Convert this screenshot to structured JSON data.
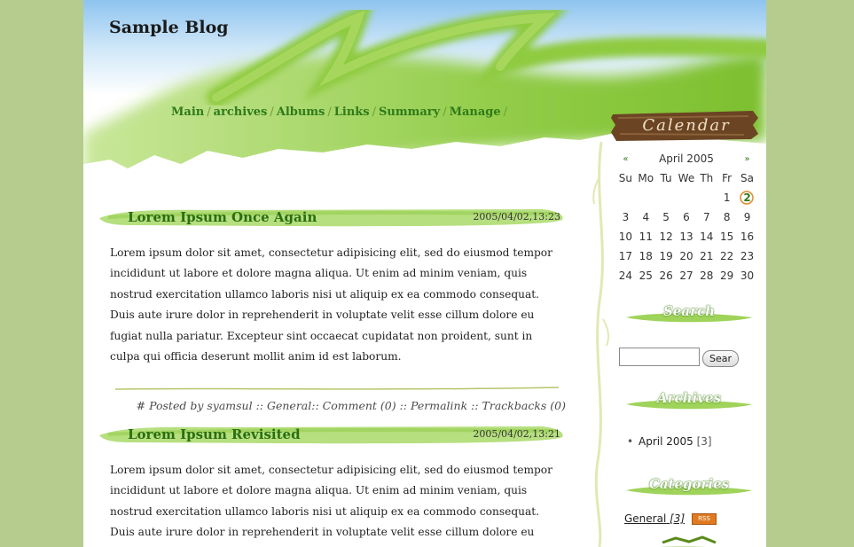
{
  "site": {
    "title": "Sample Blog"
  },
  "nav": {
    "items": [
      "Main",
      "archives",
      "Albums",
      "Links",
      "Summary",
      "Manage"
    ],
    "separator": "/"
  },
  "posts": [
    {
      "title": "Lorem Ipsum Once Again",
      "date": "2005/04/02,13:23",
      "body": "Lorem ipsum dolor sit amet, consectetur adipisicing elit, sed do eiusmod tempor incididunt ut labore et dolore magna aliqua. Ut enim ad minim veniam, quis nostrud exercitation ullamco laboris nisi ut aliquip ex ea commodo consequat. Duis aute irure dolor in reprehenderit in voluptate velit esse cillum dolore eu fugiat nulla pariatur. Excepteur sint occaecat cupidatat non proident, sunt in culpa qui officia deserunt mollit anim id est laborum.",
      "footer": {
        "prefix": "# Posted by syamsul ::",
        "category": "General",
        "comment": "Comment (0)",
        "permalink": "Permalink",
        "trackbacks": "Trackbacks (0)"
      }
    },
    {
      "title": "Lorem Ipsum Revisited",
      "date": "2005/04/02,13:21",
      "body": "Lorem ipsum dolor sit amet, consectetur adipisicing elit, sed do eiusmod tempor incididunt ut labore et dolore magna aliqua. Ut enim ad minim veniam, quis nostrud exercitation ullamco laboris nisi ut aliquip ex ea commodo consequat. Duis aute irure dolor in reprehenderit in voluptate velit esse cillum dolore eu fugiat nulla pariatur."
    }
  ],
  "sidebar": {
    "calendar": {
      "heading": "Calendar",
      "prev": "«",
      "next": "»",
      "month": "April 2005",
      "weekdays": [
        "Su",
        "Mo",
        "Tu",
        "We",
        "Th",
        "Fr",
        "Sa"
      ],
      "weeks": [
        [
          "",
          "",
          "",
          "",
          "",
          "1",
          "2"
        ],
        [
          "3",
          "4",
          "5",
          "6",
          "7",
          "8",
          "9"
        ],
        [
          "10",
          "11",
          "12",
          "13",
          "14",
          "15",
          "16"
        ],
        [
          "17",
          "18",
          "19",
          "20",
          "21",
          "22",
          "23"
        ],
        [
          "24",
          "25",
          "26",
          "27",
          "28",
          "29",
          "30"
        ]
      ],
      "today": "2"
    },
    "search": {
      "heading": "Search",
      "button": "Sear",
      "value": ""
    },
    "archives": {
      "heading": "Archives",
      "items": [
        {
          "label": "April 2005",
          "count": "[3]"
        }
      ]
    },
    "categories": {
      "heading": "Categories",
      "items": [
        {
          "label": "General",
          "count": "[3]",
          "badge": "RSS"
        }
      ]
    }
  },
  "colors": {
    "background": "#b5cc8e",
    "accent_green": "#2f7a1a",
    "brush_green": "#8ccc3c",
    "sky_blue": "#a9d4f5",
    "wood": "#6b4423"
  }
}
